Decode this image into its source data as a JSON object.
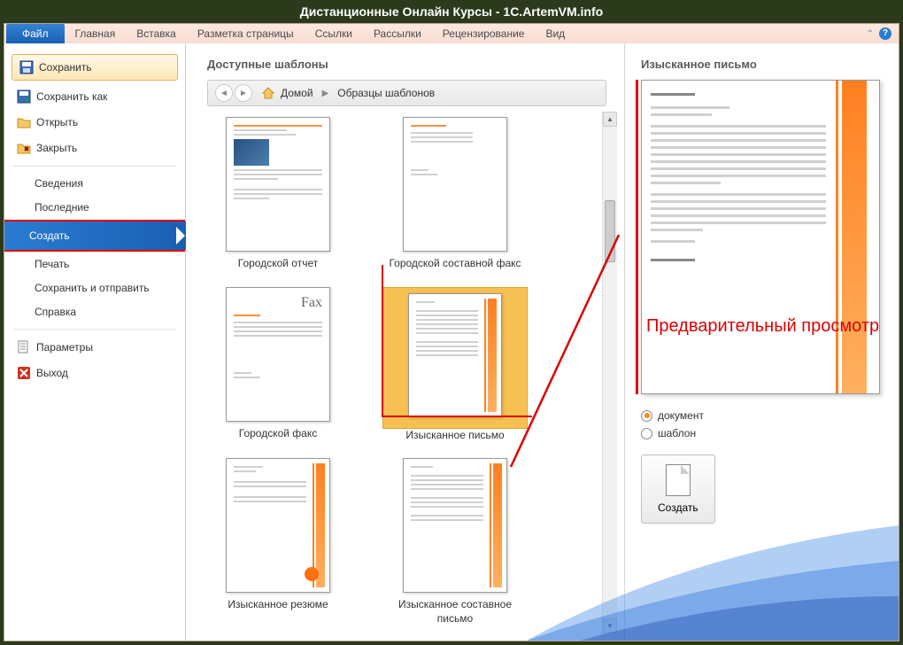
{
  "titlebar": "Дистанционные Онлайн Курсы - 1C.ArtemVM.info",
  "tabs": {
    "file": "Файл",
    "home": "Главная",
    "insert": "Вставка",
    "layout": "Разметка страницы",
    "references": "Ссылки",
    "mailings": "Рассылки",
    "review": "Рецензирование",
    "view": "Вид"
  },
  "sidebar": {
    "save": "Сохранить",
    "saveas": "Сохранить как",
    "open": "Открыть",
    "close": "Закрыть",
    "info": "Сведения",
    "recent": "Последние",
    "new": "Создать",
    "print": "Печать",
    "saveSend": "Сохранить и отправить",
    "help": "Справка",
    "options": "Параметры",
    "exit": "Выход"
  },
  "templates": {
    "heading": "Доступные шаблоны",
    "home": "Домой",
    "samples": "Образцы шаблонов",
    "items": {
      "t1": "Городской отчет",
      "t2": "Городской составной факс",
      "t3": "Городской факс",
      "t4": "Изысканное письмо",
      "t5": "Изысканное резюме",
      "t6": "Изысканное составное письмо"
    },
    "faxWord": "Fax"
  },
  "preview": {
    "heading": "Изысканное письмо",
    "annotation": "Предварительный просмотр",
    "radioDoc": "документ",
    "radioTpl": "шаблон",
    "createBtn": "Создать"
  }
}
